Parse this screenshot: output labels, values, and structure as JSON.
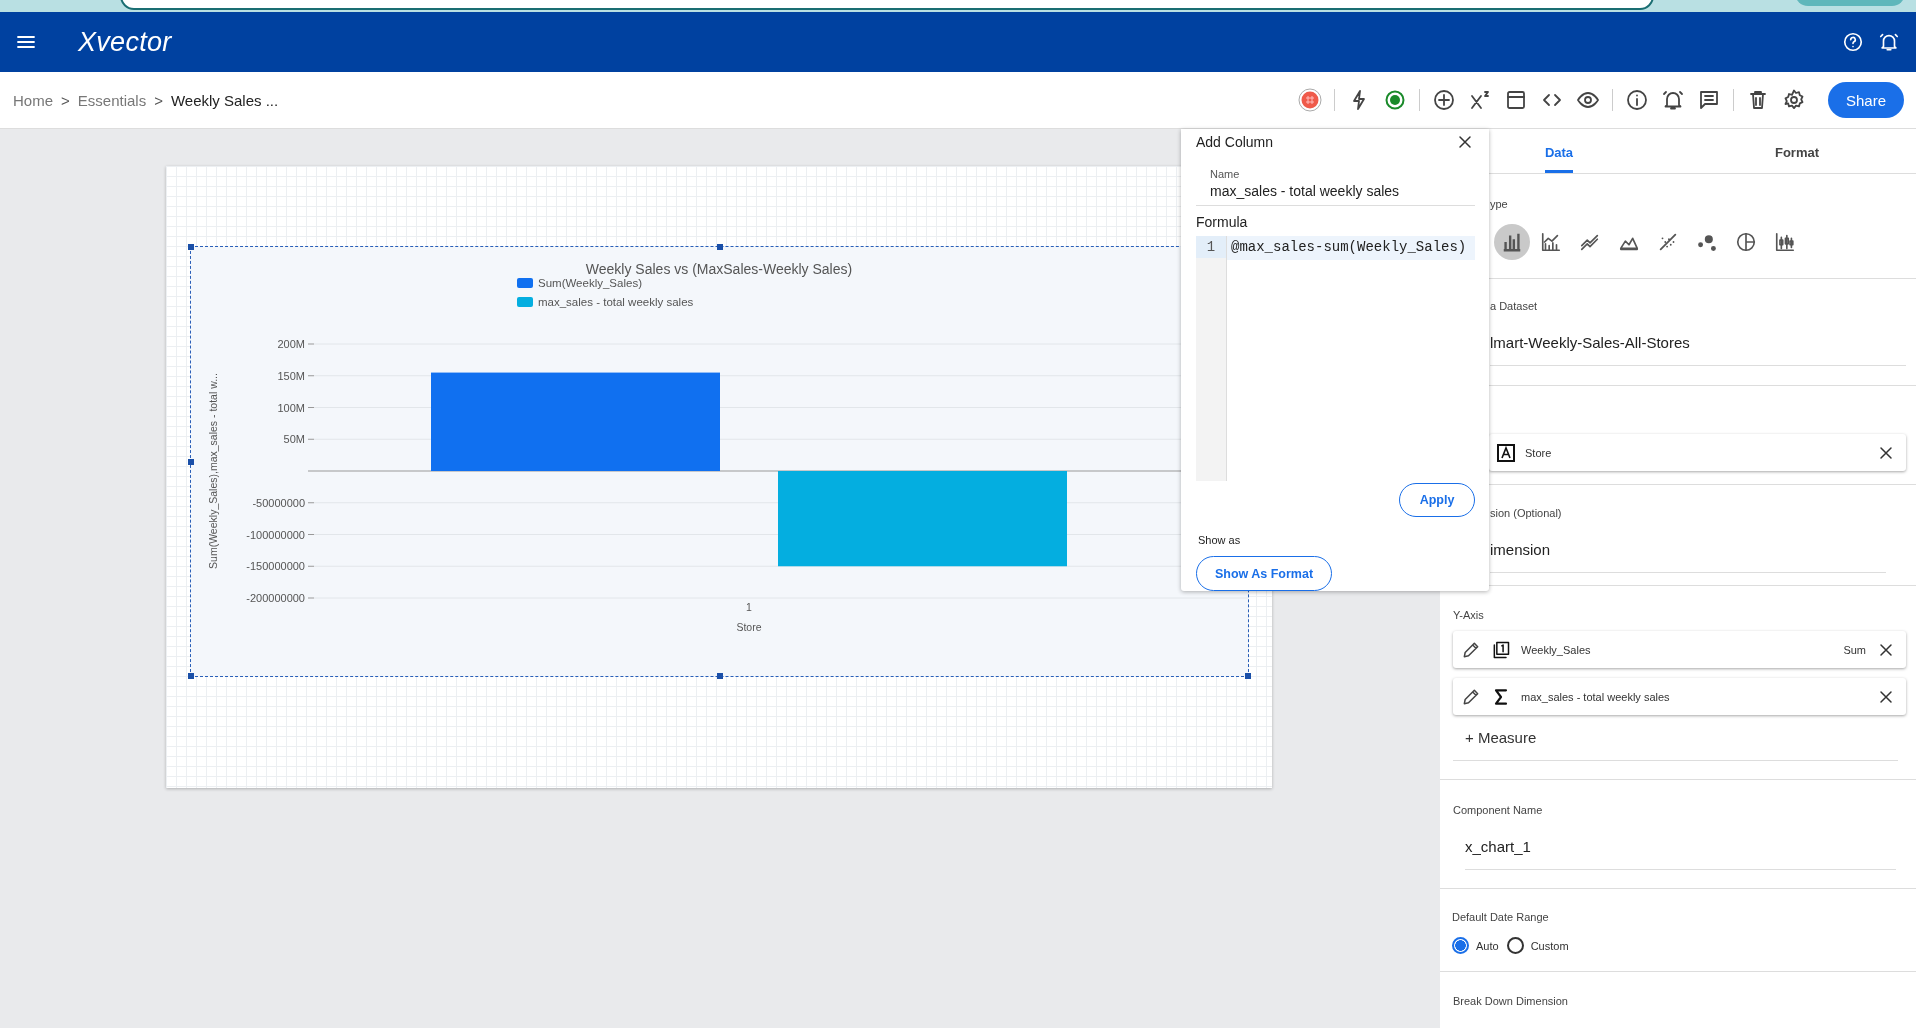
{
  "header": {
    "logo": "Xvector"
  },
  "breadcrumb": {
    "separator": ">",
    "items": [
      {
        "label": "Home",
        "current": false
      },
      {
        "label": "Essentials",
        "current": false
      },
      {
        "label": "Weekly Sales ...",
        "current": true
      }
    ]
  },
  "toolbar": {
    "share": "Share"
  },
  "chart": {
    "chart_data": {
      "type": "bar",
      "title": "Weekly Sales vs (MaxSales-Weekly Sales)",
      "xlabel": "Store",
      "ylabel": "Sum(Weekly_Sales),max_sales - total w...",
      "categories": [
        "1"
      ],
      "series": [
        {
          "name": "Sum(Weekly_Sales)",
          "color": "#1070f0",
          "values": [
            155000000
          ]
        },
        {
          "name": "max_sales - total weekly sales",
          "color": "#04aee0",
          "values": [
            -150000000
          ]
        }
      ],
      "ylim": [
        -200000000,
        200000000
      ],
      "grid": true,
      "legend": true,
      "yticks": [
        {
          "value": 200000000,
          "label": "200M"
        },
        {
          "value": 150000000,
          "label": "150M"
        },
        {
          "value": 100000000,
          "label": "100M"
        },
        {
          "value": 50000000,
          "label": "50M"
        },
        {
          "value": -50000000,
          "label": "-50000000"
        },
        {
          "value": -100000000,
          "label": "-100000000"
        },
        {
          "value": -150000000,
          "label": "-150000000"
        },
        {
          "value": -200000000,
          "label": "-200000000"
        }
      ]
    }
  },
  "add_column": {
    "title": "Add Column",
    "name_label": "Name",
    "name_value": "max_sales - total weekly sales",
    "formula_label": "Formula",
    "line_number": "1",
    "formula": "@max_sales-sum(Weekly_Sales)",
    "apply": "Apply",
    "show_as_label": "Show as",
    "show_as_button": "Show As Format"
  },
  "panel": {
    "tabs": [
      {
        "label": "Data",
        "selected": true
      },
      {
        "label": "Format",
        "selected": false
      }
    ],
    "chart_type_label": "ype",
    "chart_types": [
      {
        "kind": "bar",
        "selected": true
      },
      {
        "kind": "combo",
        "selected": false
      },
      {
        "kind": "line",
        "selected": false
      },
      {
        "kind": "area",
        "selected": false
      },
      {
        "kind": "scatter",
        "selected": false
      },
      {
        "kind": "bubble",
        "selected": false
      },
      {
        "kind": "pie",
        "selected": false
      },
      {
        "kind": "candlestick",
        "selected": false
      }
    ],
    "dataset_label": "a Dataset",
    "dataset": "lmart-Weekly-Sales-All-Stores",
    "x_axis": {
      "name": "Store"
    },
    "dimension_label": "sion (Optional)",
    "dimension": "imension",
    "y_axis_label": "Y-Axis",
    "measures": [
      {
        "kind": "count",
        "name": "Weekly_Sales",
        "aggregation": "Sum"
      },
      {
        "kind": "formula",
        "name": "max_sales - total weekly sales"
      }
    ],
    "add_measure": "+ Measure",
    "component_name_label": "Component Name",
    "component_name": "x_chart_1",
    "date_range": {
      "label": "Default Date Range",
      "options": [
        {
          "label": "Auto",
          "selected": true
        },
        {
          "label": "Custom",
          "selected": false
        }
      ]
    },
    "breakdown_label": "Break Down Dimension"
  }
}
